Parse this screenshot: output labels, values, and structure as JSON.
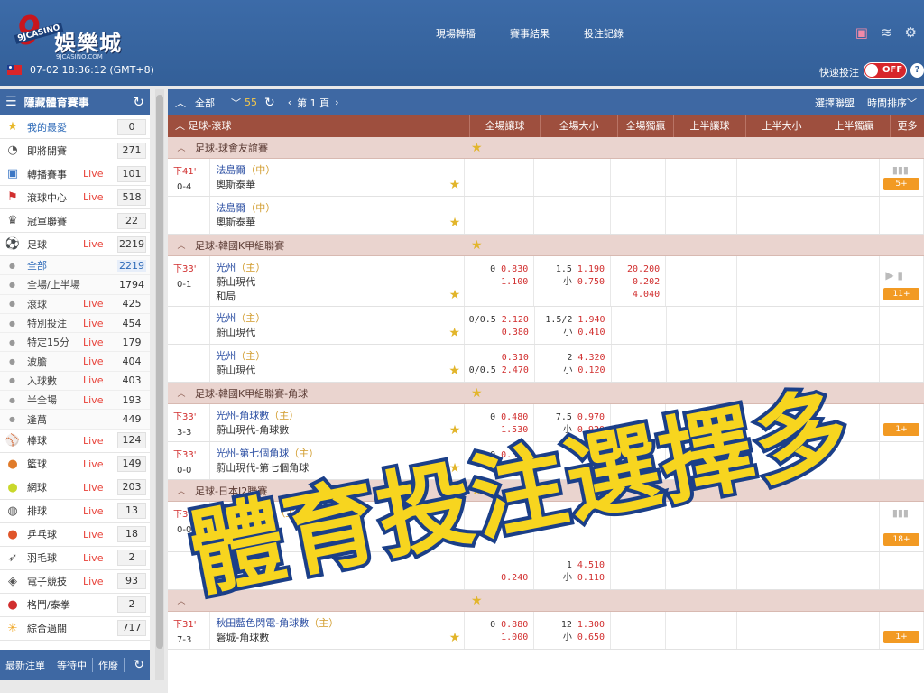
{
  "header": {
    "logo_number": "9",
    "logo_casino": "9JCASINO",
    "logo_brand": "娛樂城",
    "logo_site": "9JCASINO.COM",
    "nav": [
      "現場轉播",
      "賽事結果",
      "投注記錄"
    ],
    "datetime": "07-02 18:36:12 (GMT+8)",
    "quick_bet_label": "快速投注",
    "toggle_label": "OFF",
    "help": "?"
  },
  "sidebar": {
    "title": "隱藏體育賽事",
    "items": [
      {
        "name": "我的最愛",
        "live": "",
        "count": "0",
        "icon": "star-icon"
      },
      {
        "name": "即將開賽",
        "live": "",
        "count": "271",
        "icon": "whistle-icon"
      },
      {
        "name": "轉播賽事",
        "live": "Live",
        "count": "101",
        "icon": "tv-icon"
      },
      {
        "name": "滾球中心",
        "live": "Live",
        "count": "518",
        "icon": "runner-icon"
      },
      {
        "name": "冠軍聯賽",
        "live": "",
        "count": "22",
        "icon": "trophy-icon"
      },
      {
        "name": "足球",
        "live": "Live",
        "count": "2219",
        "icon": "soccer-icon"
      }
    ],
    "sub_items": [
      {
        "name": "全部",
        "live": "",
        "count": "2219"
      },
      {
        "name": "全場/上半場",
        "live": "",
        "count": "1794"
      },
      {
        "name": "滾球",
        "live": "Live",
        "count": "425"
      },
      {
        "name": "特別投注",
        "live": "Live",
        "count": "454"
      },
      {
        "name": "特定15分",
        "live": "Live",
        "count": "179"
      },
      {
        "name": "波膽",
        "live": "Live",
        "count": "404"
      },
      {
        "name": "入球數",
        "live": "Live",
        "count": "403"
      },
      {
        "name": "半全場",
        "live": "Live",
        "count": "193"
      },
      {
        "name": "逢萬",
        "live": "",
        "count": "449"
      }
    ],
    "sports": [
      {
        "name": "棒球",
        "live": "Live",
        "count": "124",
        "icon": "baseball-icon"
      },
      {
        "name": "籃球",
        "live": "Live",
        "count": "149",
        "icon": "basketball-icon"
      },
      {
        "name": "網球",
        "live": "Live",
        "count": "203",
        "icon": "tennis-icon"
      },
      {
        "name": "排球",
        "live": "Live",
        "count": "13",
        "icon": "volleyball-icon"
      },
      {
        "name": "乒乓球",
        "live": "Live",
        "count": "18",
        "icon": "pingpong-icon"
      },
      {
        "name": "羽毛球",
        "live": "Live",
        "count": "2",
        "icon": "badminton-icon"
      },
      {
        "name": "電子競技",
        "live": "Live",
        "count": "93",
        "icon": "gamepad-icon"
      },
      {
        "name": "格鬥/泰拳",
        "live": "",
        "count": "2",
        "icon": "boxing-icon"
      },
      {
        "name": "綜合過關",
        "live": "",
        "count": "717",
        "icon": "parlay-icon"
      }
    ],
    "footer": [
      "最新注單",
      "等待中",
      "作廢"
    ]
  },
  "toolbar": {
    "all_label": "全部",
    "count": "55",
    "page_label": "第 1 頁",
    "select_league": "選擇聯盟",
    "sort_label": "時間排序"
  },
  "columns": [
    "足球-滾球",
    "全場讓球",
    "全場大小",
    "全場獨贏",
    "上半讓球",
    "上半大小",
    "上半獨贏",
    "更多"
  ],
  "groups": [
    {
      "league": "足球-球會友誼賽",
      "matches": [
        {
          "minute": "下41'",
          "score": "0-4",
          "home": "法島爾",
          "home_tag": "（中）",
          "away": "奧斯泰華",
          "draw": "",
          "hdp": [],
          "ou": [],
          "x12": [],
          "more": "5+",
          "icons": "bars"
        },
        {
          "minute": "",
          "score": "",
          "home": "法島爾",
          "home_tag": "（中）",
          "away": "奧斯泰華",
          "draw": "",
          "hdp": [],
          "ou": [],
          "x12": [],
          "more": "",
          "icons": ""
        }
      ]
    },
    {
      "league": "足球-韓國K甲組聯賽",
      "matches": [
        {
          "minute": "下33'",
          "score": "0-1",
          "home": "光州",
          "home_tag": "（主）",
          "away": "蔚山現代",
          "draw": "和局",
          "hdp": [
            {
              "h": "0",
              "o": "0.830"
            },
            {
              "h": "",
              "o": "1.100"
            }
          ],
          "ou": [
            {
              "h": "1.5",
              "o": "1.190"
            },
            {
              "h": "小",
              "o": "0.750"
            }
          ],
          "x12": [
            "20.200",
            "0.202",
            "4.040"
          ],
          "more": "11+",
          "icons": "play"
        },
        {
          "minute": "",
          "score": "",
          "home": "光州",
          "home_tag": "（主）",
          "away": "蔚山現代",
          "draw": "",
          "hdp": [
            {
              "h": "0/0.5",
              "o": "2.120"
            },
            {
              "h": "",
              "o": "0.380"
            }
          ],
          "ou": [
            {
              "h": "1.5/2",
              "o": "1.940"
            },
            {
              "h": "小",
              "o": "0.410"
            }
          ],
          "x12": [],
          "more": "",
          "icons": ""
        },
        {
          "minute": "",
          "score": "",
          "home": "光州",
          "home_tag": "（主）",
          "away": "蔚山現代",
          "draw": "",
          "hdp": [
            {
              "h": "",
              "o": "0.310"
            },
            {
              "h": "0/0.5",
              "o": "2.470"
            }
          ],
          "ou": [
            {
              "h": "2",
              "o": "4.320"
            },
            {
              "h": "小",
              "o": "0.120"
            }
          ],
          "x12": [],
          "more": "",
          "icons": ""
        }
      ]
    },
    {
      "league": "足球-韓國K甲組聯賽-角球",
      "matches": [
        {
          "minute": "下33'",
          "score": "3-3",
          "home": "光州-角球數",
          "home_tag": "（主）",
          "away": "蔚山現代-角球數",
          "draw": "",
          "hdp": [
            {
              "h": "0",
              "o": "0.480"
            },
            {
              "h": "",
              "o": "1.530"
            }
          ],
          "ou": [
            {
              "h": "7.5",
              "o": "0.970"
            },
            {
              "h": "小",
              "o": "0.920"
            }
          ],
          "x12": [],
          "more": "1+",
          "icons": ""
        },
        {
          "minute": "下33'",
          "score": "0-0",
          "home": "光州-第七個角球",
          "home_tag": "（主）",
          "away": "蔚山現代-第七個角球",
          "draw": "",
          "hdp": [
            {
              "h": "0",
              "o": "0.510"
            },
            {
              "h": "",
              "o": "1.530"
            }
          ],
          "ou": [],
          "x12": [],
          "more": "",
          "icons": ""
        }
      ]
    },
    {
      "league": "足球-日本J2聯賽",
      "matches": [
        {
          "minute": "下31'",
          "score": "0-0",
          "home": "秋田藍色閃電",
          "home_tag": "（主）",
          "away": "磐城",
          "draw": "和局",
          "hdp": [],
          "ou": [],
          "x12": [],
          "more": "18+",
          "icons": "bars"
        },
        {
          "minute": "",
          "score": "",
          "home": "",
          "home_tag": "",
          "away": "",
          "draw": "",
          "hdp": [
            {
              "h": "",
              "o": ""
            },
            {
              "h": "",
              "o": "0.240"
            }
          ],
          "ou": [
            {
              "h": "1",
              "o": "4.510"
            },
            {
              "h": "小",
              "o": "0.110"
            }
          ],
          "x12": [],
          "more": "",
          "icons": ""
        }
      ]
    },
    {
      "league": "",
      "matches": [
        {
          "minute": "下31'",
          "score": "7-3",
          "home": "秋田藍色閃電-角球數",
          "home_tag": "（主）",
          "away": "磐城-角球數",
          "draw": "",
          "hdp": [
            {
              "h": "0",
              "o": "0.880"
            },
            {
              "h": "",
              "o": "1.000"
            }
          ],
          "ou": [
            {
              "h": "12",
              "o": "1.300"
            },
            {
              "h": "小",
              "o": "0.650"
            }
          ],
          "x12": [],
          "more": "1+",
          "icons": ""
        }
      ]
    }
  ],
  "overlay_text": "體育投注選擇多"
}
